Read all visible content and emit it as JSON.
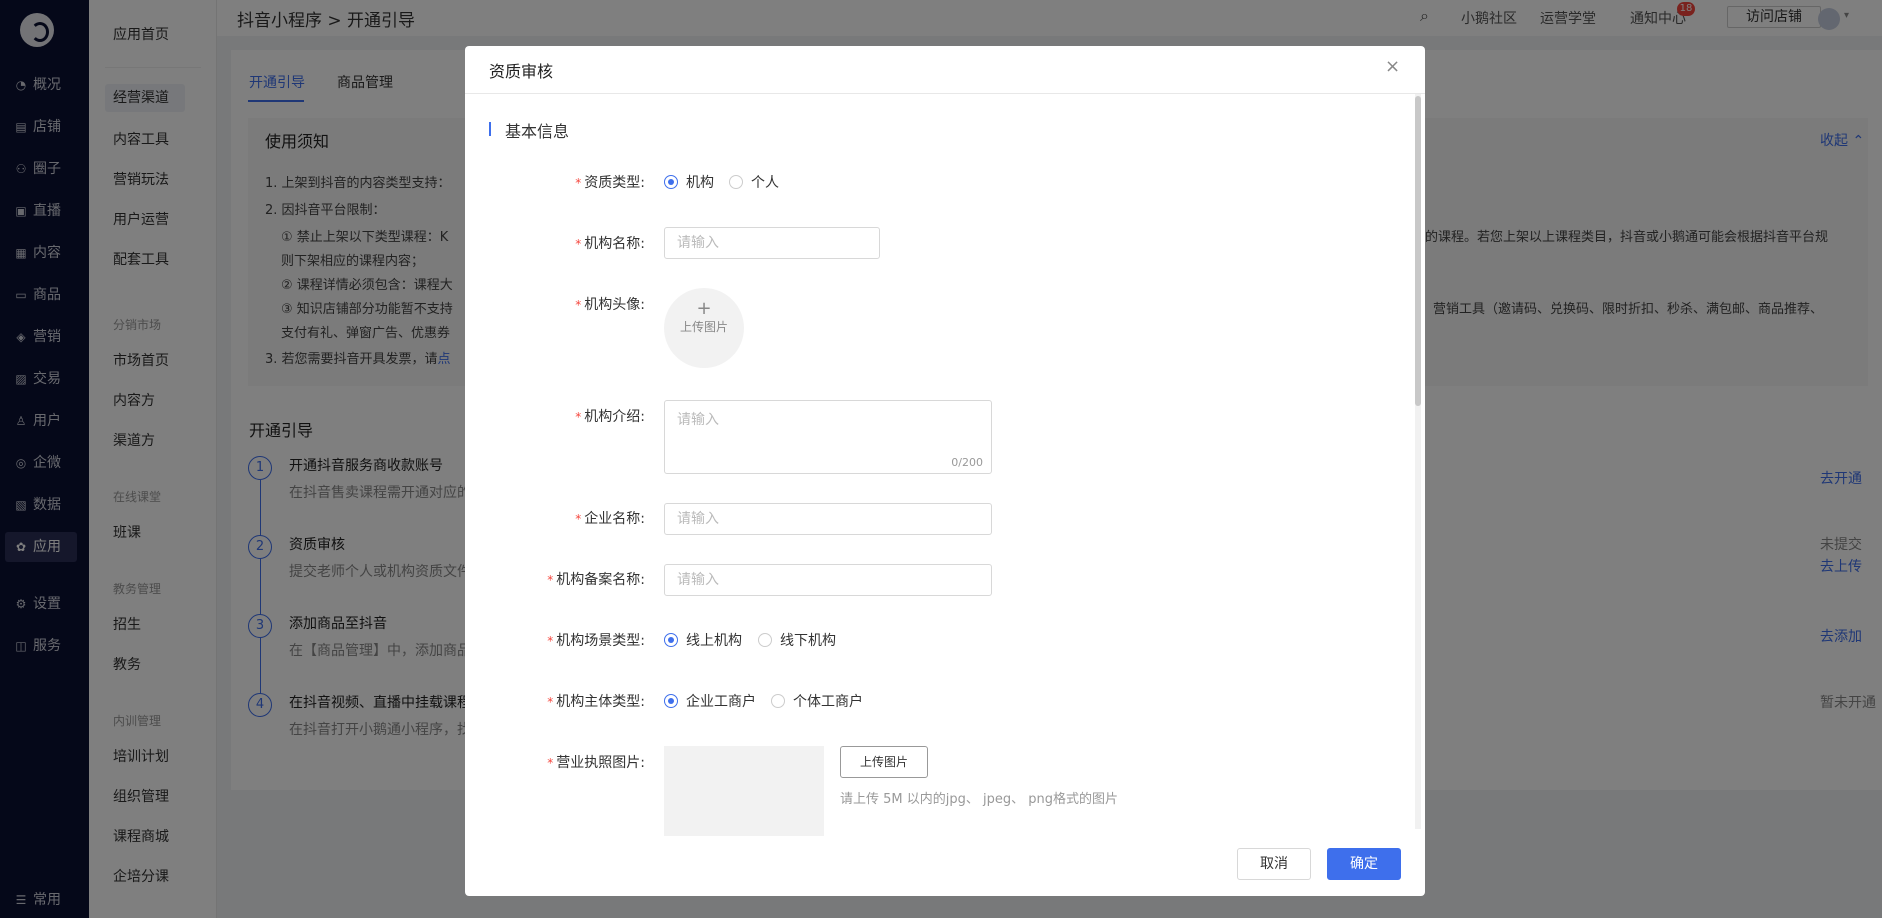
{
  "nav": {
    "items": [
      {
        "icon": "◔",
        "label": "概况"
      },
      {
        "icon": "▤",
        "label": "店铺"
      },
      {
        "icon": "⚇",
        "label": "圈子"
      },
      {
        "icon": "▣",
        "label": "直播"
      },
      {
        "icon": "▦",
        "label": "内容"
      },
      {
        "icon": "▭",
        "label": "商品"
      },
      {
        "icon": "◈",
        "label": "营销"
      },
      {
        "icon": "▨",
        "label": "交易"
      },
      {
        "icon": "♙",
        "label": "用户"
      },
      {
        "icon": "◎",
        "label": "企微"
      },
      {
        "icon": "▧",
        "label": "数据"
      },
      {
        "icon": "✿",
        "label": "应用"
      },
      {
        "icon": "⚙",
        "label": "设置"
      },
      {
        "icon": "◫",
        "label": "服务"
      },
      {
        "icon": "☰",
        "label": "常用"
      }
    ]
  },
  "sub": {
    "home": "应用首页",
    "items1": [
      "经营渠道",
      "内容工具",
      "营销玩法",
      "用户运营",
      "配套工具"
    ],
    "group1": "分销市场",
    "items2": [
      "市场首页",
      "内容方",
      "渠道方"
    ],
    "group2": "在线课堂",
    "items3": [
      "班课"
    ],
    "group3": "教务管理",
    "items4": [
      "招生",
      "教务"
    ],
    "group4": "内训管理",
    "items5": [
      "培训计划",
      "组织管理",
      "课程商城",
      "企培分课"
    ]
  },
  "topbar": {
    "breadcrumb": "抖音小程序 > 开通引导",
    "links": [
      "小鹅社区",
      "运营学堂",
      "通知中心"
    ],
    "badge": "18",
    "visit": "访问店铺"
  },
  "bg": {
    "tabs": [
      "开通引导",
      "商品管理"
    ],
    "notice_title": "使用须知",
    "collapse": "收起 ⌃",
    "lines": [
      "1. 上架到抖音的内容类型支持：",
      "2. 因抖音平台限制：",
      "① 禁止上架以下类型课程：K",
      "则下架相应的课程内容；",
      "② 课程详情必须包含：课程大",
      "③ 知识店铺部分功能暂不支持",
      "支付有礼、弹窗广告、优惠券",
      "3. 若您需要抖音开具发票，请"
    ],
    "line_tail1": "的课程。若您上架以上课程类目，抖音或小鹅通可能会根据抖音平台规",
    "line_tail2": "营销工具（邀请码、兑换码、限时折扣、秒杀、满包邮、商品推荐、",
    "line3_link": "点",
    "guide_title": "开通引导",
    "steps": [
      {
        "n": "1",
        "title": "开通抖音服务商收款账号",
        "desc": "在抖音售卖课程需开通对应的",
        "action": "去开通",
        "status": ""
      },
      {
        "n": "2",
        "title": "资质审核",
        "desc": "提交老师个人或机构资质文件",
        "action": "去上传",
        "status": "未提交"
      },
      {
        "n": "3",
        "title": "添加商品至抖音",
        "desc": "在【商品管理】中，添加商品",
        "action": "去添加",
        "status": ""
      },
      {
        "n": "4",
        "title": "在抖音视频、直播中挂载课程",
        "desc": "在抖音打开小鹅通小程序，找",
        "action": "",
        "status": "暂未开通"
      }
    ]
  },
  "modal": {
    "title": "资质审核",
    "close": "×",
    "section": "基本信息",
    "type_label": "资质类型:",
    "type_opts": [
      "机构",
      "个人"
    ],
    "name_label": "机构名称:",
    "name_ph": "请输入",
    "avatar_label": "机构头像:",
    "upload_plus": "+",
    "upload_text": "上传图片",
    "intro_label": "机构介绍:",
    "intro_ph": "请输入",
    "intro_count": "0/200",
    "company_label": "企业名称:",
    "company_ph": "请输入",
    "record_label": "机构备案名称:",
    "record_ph": "请输入",
    "scene_label": "机构场景类型:",
    "scene_opts": [
      "线上机构",
      "线下机构"
    ],
    "subject_label": "机构主体类型:",
    "subject_opts": [
      "企业工商户",
      "个体工商户"
    ],
    "license_label": "营业执照图片:",
    "license_btn": "上传图片",
    "license_tip": "请上传 5M 以内的jpg、 jpeg、 png格式的图片",
    "cancel": "取消",
    "ok": "确定"
  }
}
